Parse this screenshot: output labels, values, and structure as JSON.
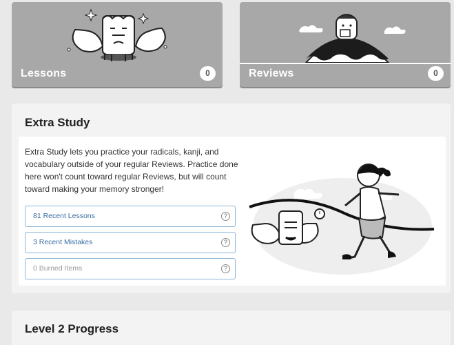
{
  "tiles": {
    "lessons": {
      "label": "Lessons",
      "count": "0"
    },
    "reviews": {
      "label": "Reviews",
      "count": "0"
    }
  },
  "extra_study": {
    "title": "Extra Study",
    "description": "Extra Study lets you practice your radicals, kanji, and vocabulary outside of your regular Reviews. Practice done here won't count toward regular Reviews, but will count toward making your memory stronger!",
    "buttons": [
      {
        "label": "81 Recent Lessons",
        "help": "?"
      },
      {
        "label": "3 Recent Mistakes",
        "help": "?"
      },
      {
        "label": "0 Burned Items",
        "help": "?"
      }
    ]
  },
  "level_progress": {
    "title": "Level 2 Progress"
  }
}
